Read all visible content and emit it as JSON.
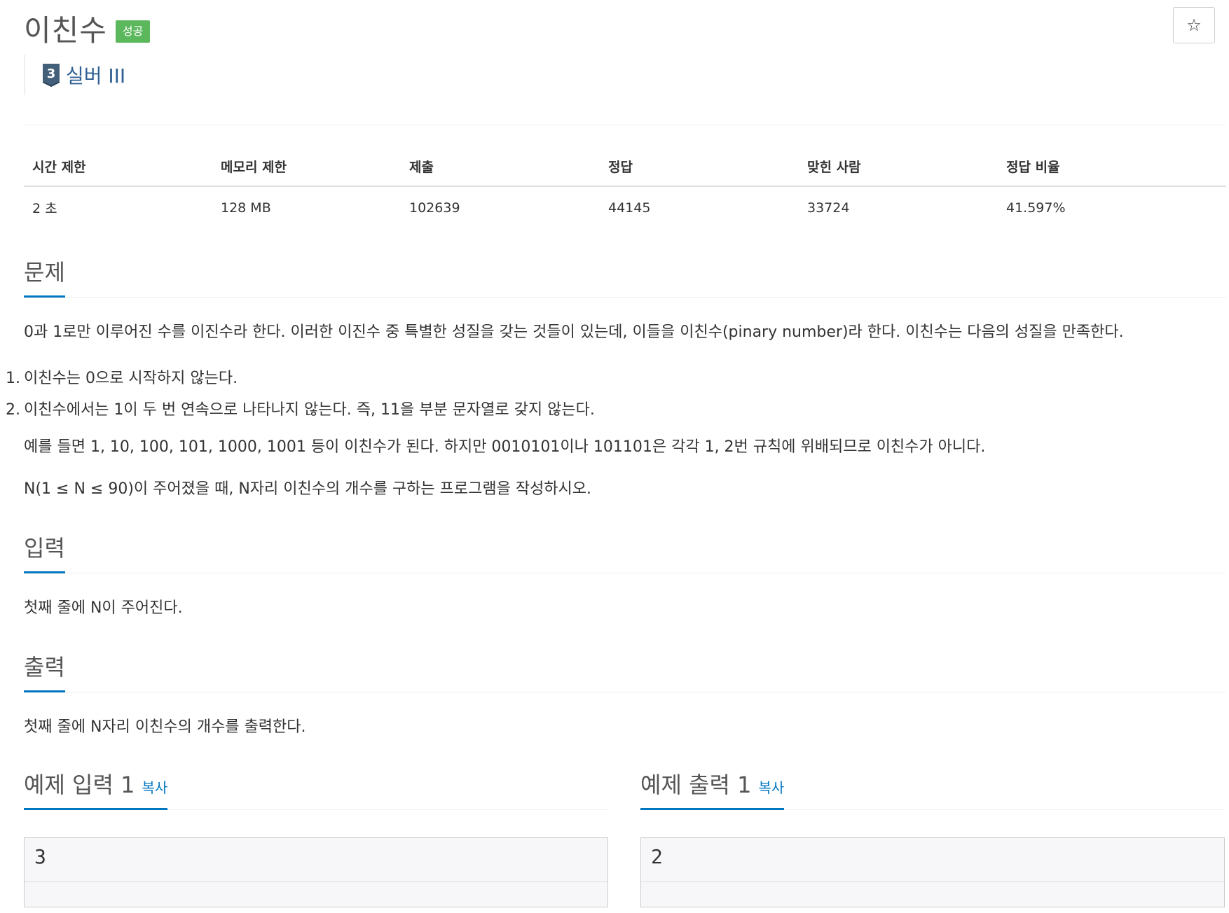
{
  "header": {
    "title": "이친수",
    "status_badge": "성공",
    "star_icon": "☆",
    "tier_number": "3",
    "tier_label": "실버 III",
    "tier_color": "#435f7a"
  },
  "info_table": {
    "headers": [
      "시간 제한",
      "메모리 제한",
      "제출",
      "정답",
      "맞힌 사람",
      "정답 비율"
    ],
    "values": [
      "2 초",
      "128 MB",
      "102639",
      "44145",
      "33724",
      "41.597%"
    ]
  },
  "problem": {
    "heading": "문제",
    "intro": "0과 1로만 이루어진 수를 이진수라 한다. 이러한 이진수 중 특별한 성질을 갖는 것들이 있는데, 이들을 이친수(pinary number)라 한다. 이친수는 다음의 성질을 만족한다.",
    "rules": [
      {
        "num": "1.",
        "text": "이친수는 0으로 시작하지 않는다."
      },
      {
        "num": "2.",
        "text": "이친수에서는 1이 두 번 연속으로 나타나지 않는다. 즉, 11을 부분 문자열로 갖지 않는다."
      }
    ],
    "example_text": "예를 들면 1, 10, 100, 101, 1000, 1001 등이 이친수가 된다. 하지만 0010101이나 101101은 각각 1, 2번 규칙에 위배되므로 이친수가 아니다.",
    "task": "N(1 ≤ N ≤ 90)이 주어졌을 때, N자리 이친수의 개수를 구하는 프로그램을 작성하시오."
  },
  "input": {
    "heading": "입력",
    "text": "첫째 줄에 N이 주어진다."
  },
  "output": {
    "heading": "출력",
    "text": "첫째 줄에 N자리 이친수의 개수를 출력한다."
  },
  "samples": {
    "input_heading": "예제 입력 1",
    "output_heading": "예제 출력 1",
    "copy_label": "복사",
    "input_value": "3",
    "output_value": "2"
  },
  "colors": {
    "accent": "#0076c0",
    "success": "#5cb85c"
  }
}
